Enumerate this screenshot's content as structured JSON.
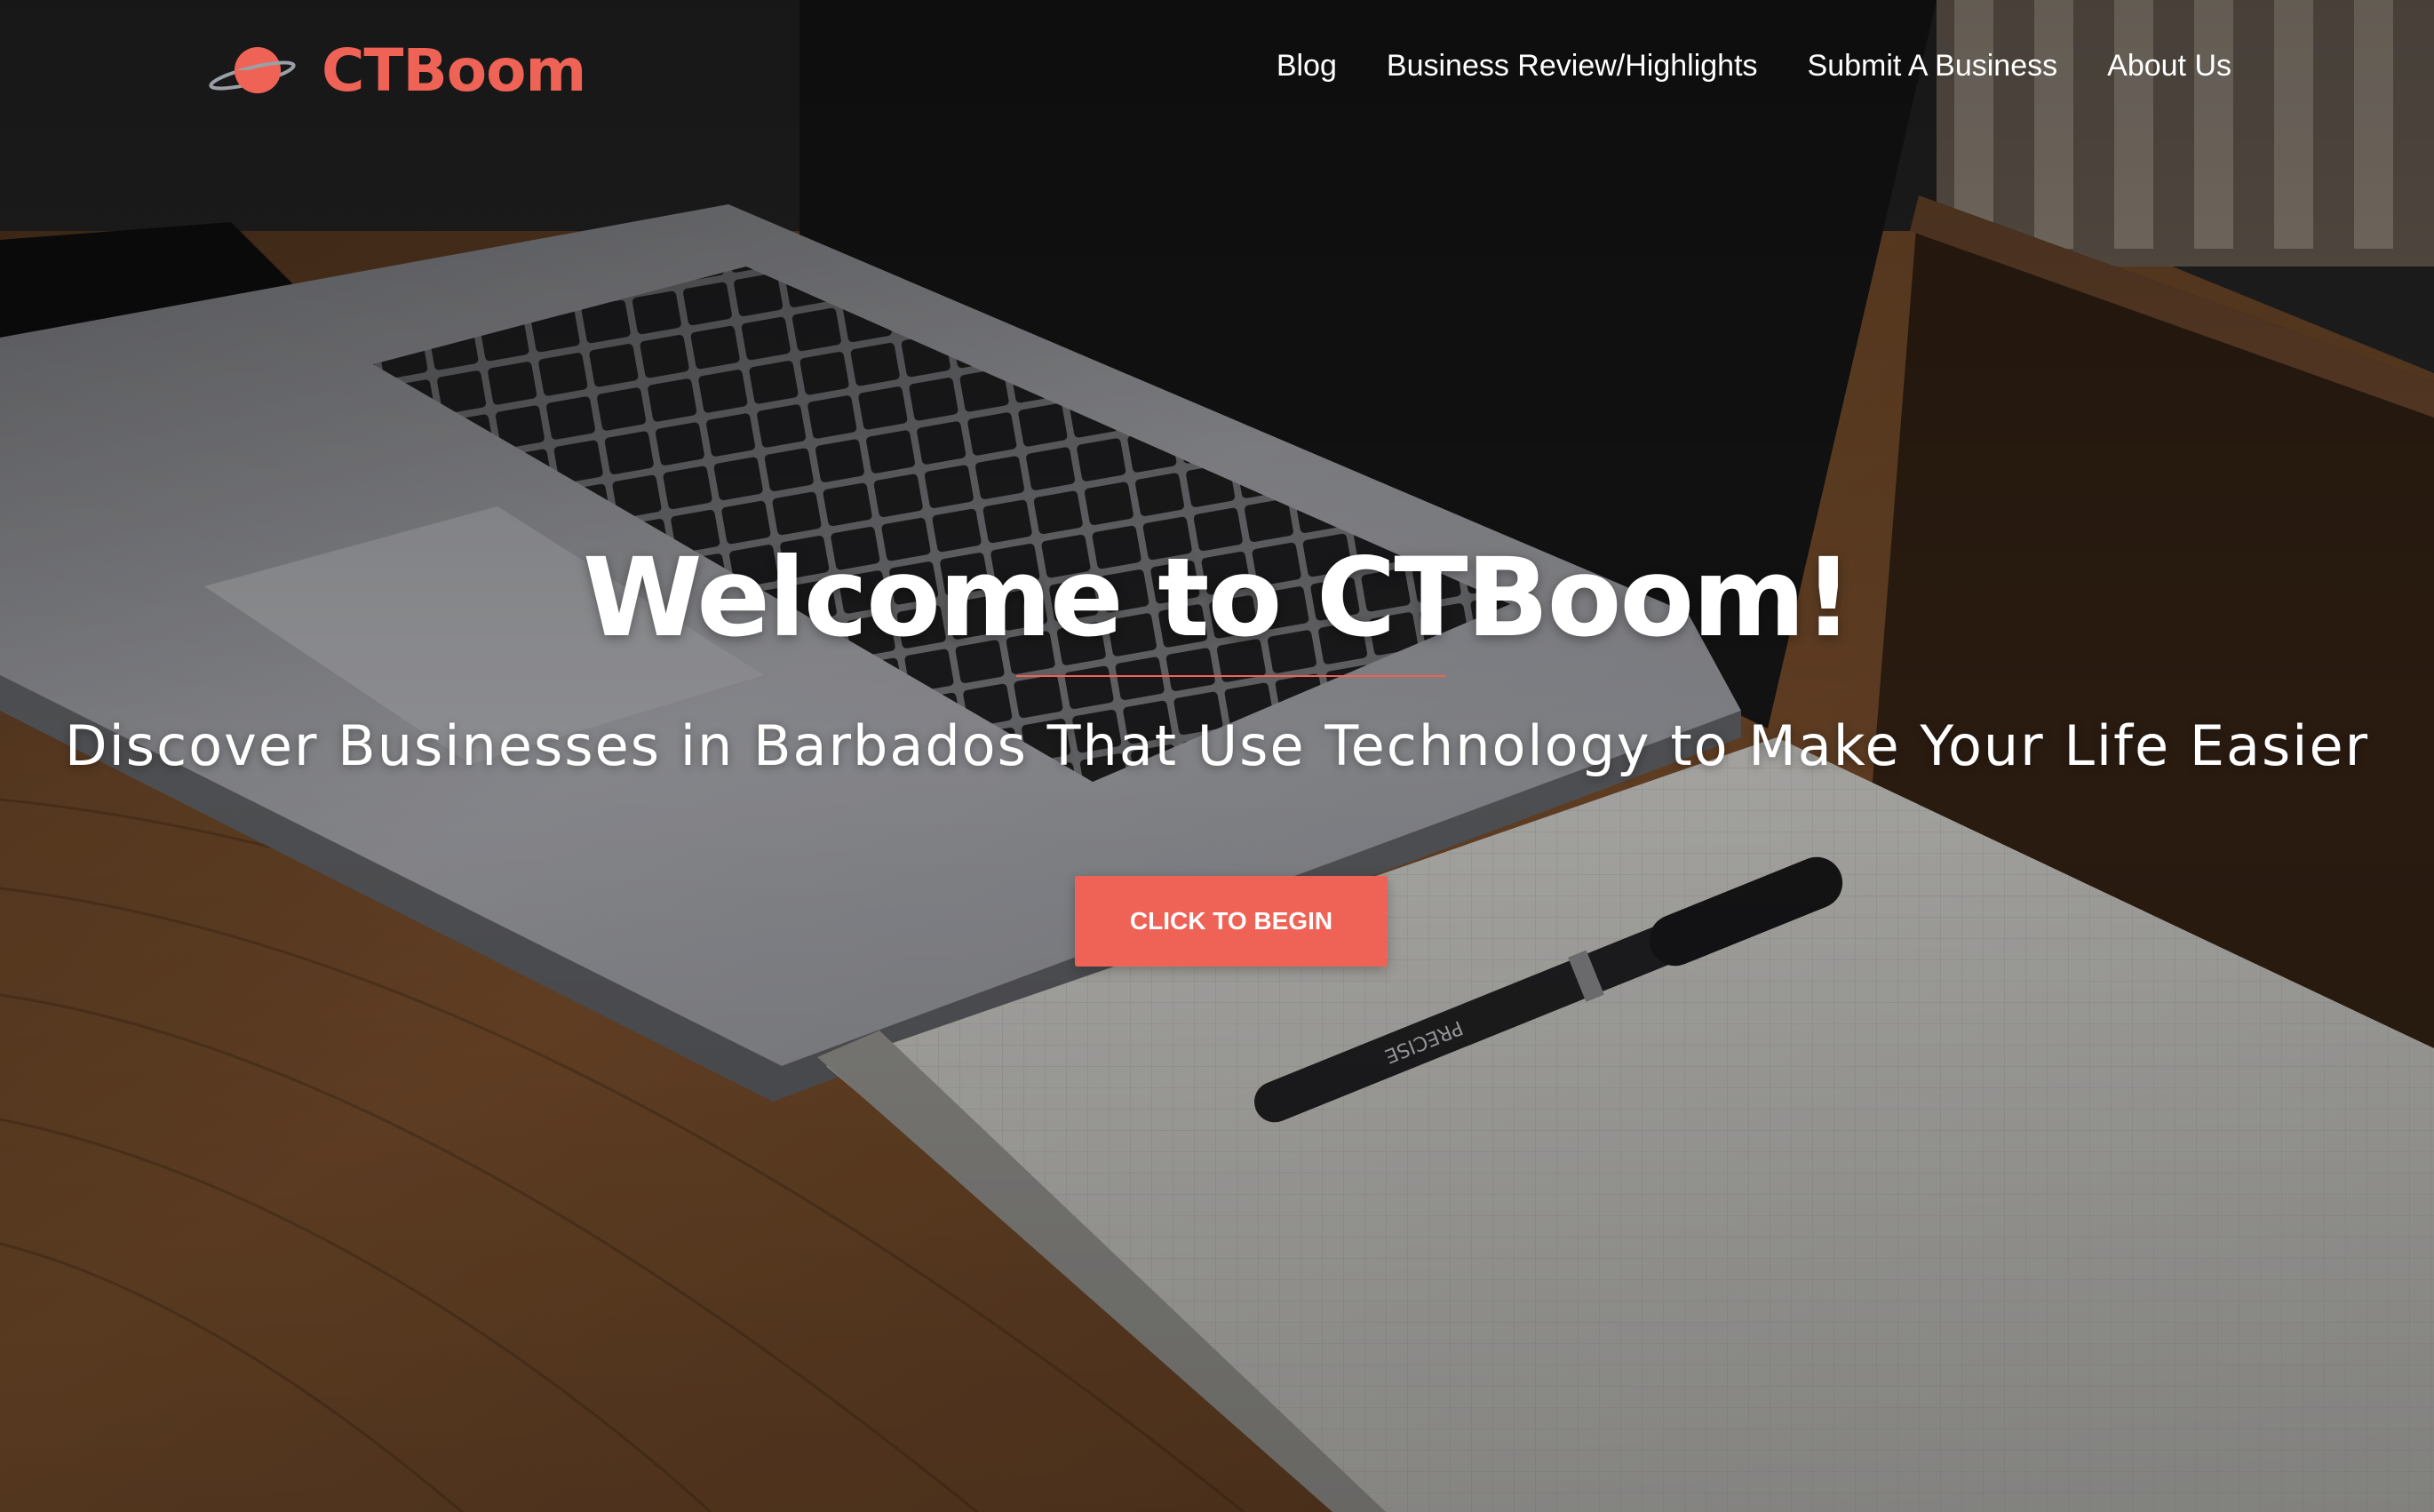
{
  "brand": {
    "name": "CTBoom",
    "logo_icon": "planet-icon",
    "accent_color": "#ef6356"
  },
  "nav": {
    "items": [
      {
        "label": "Blog"
      },
      {
        "label": "Business Review/Highlights"
      },
      {
        "label": "Submit A Business"
      },
      {
        "label": "About Us"
      }
    ]
  },
  "hero": {
    "title": "Welcome to CTBoom!",
    "subtitle": "Discover Businesses in Barbados That Use Technology to Make Your Life Easier",
    "cta_label": "CLICK TO BEGIN",
    "background": "laptop-notebook-pen-desk-photo"
  }
}
